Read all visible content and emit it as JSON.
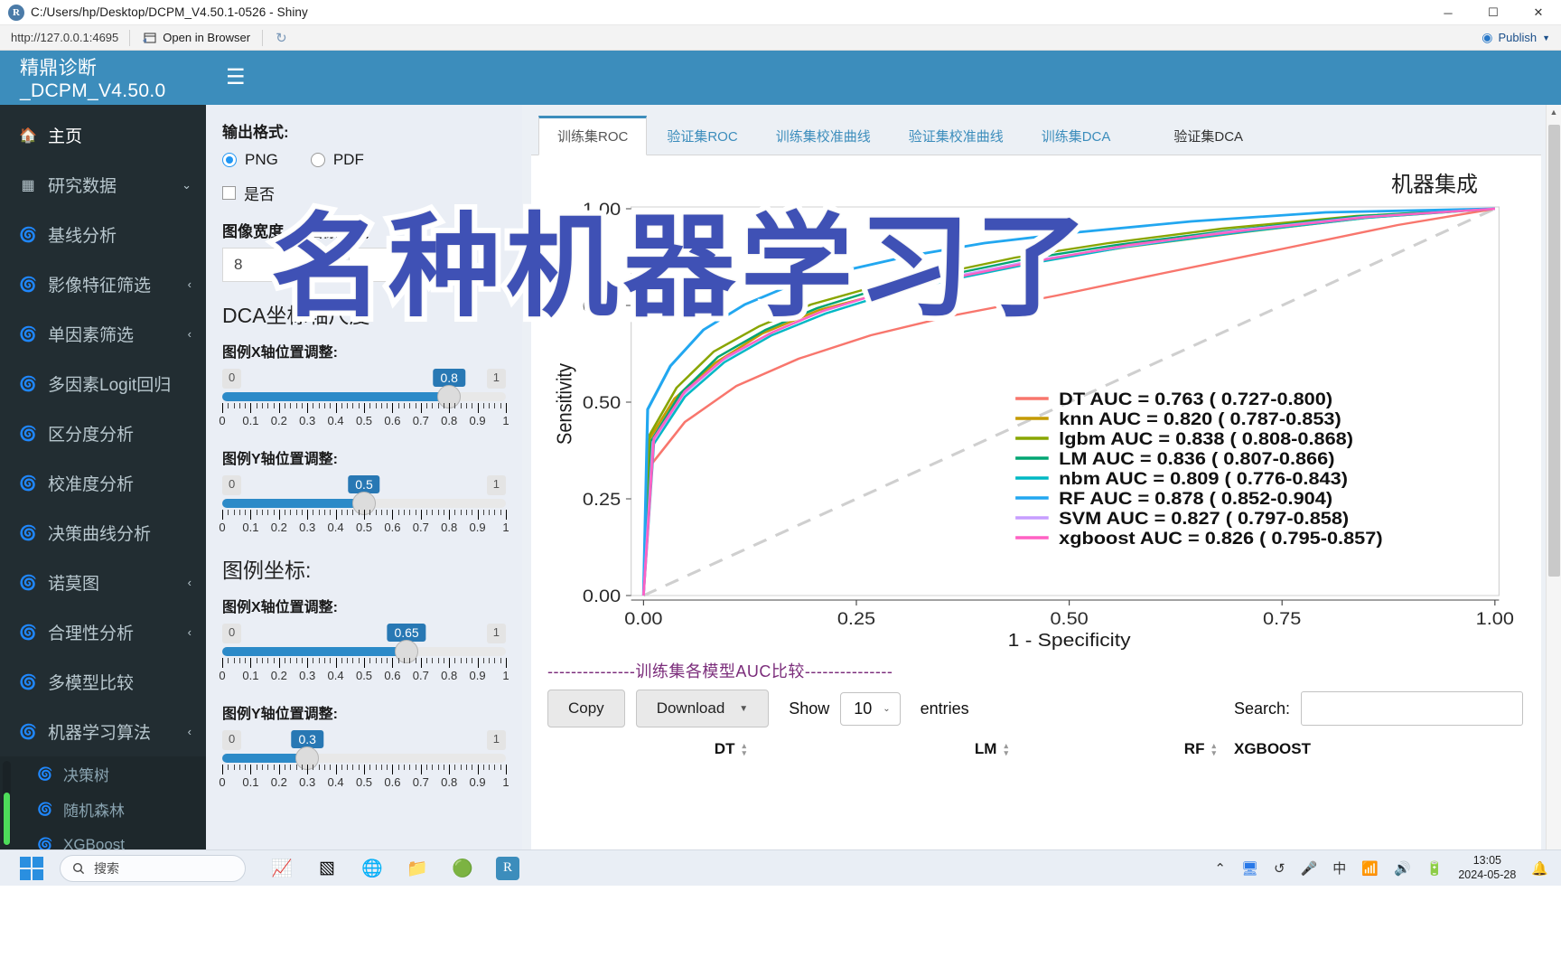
{
  "window": {
    "title": "C:/Users/hp/Desktop/DCPM_V4.50.1-0526 - Shiny",
    "app_icon": "R",
    "minimize": "─",
    "maximize": "☐",
    "close": "✕"
  },
  "shiny_toolbar": {
    "url": "http://127.0.0.1:4695",
    "open_in_browser": "Open in Browser",
    "reload_icon": "reload-icon",
    "publish_label": "Publish",
    "publish_caret": "▼"
  },
  "brand": {
    "title": "精鼎诊断_DCPM_V4.50.0"
  },
  "topbar": {
    "hamburger": "☰"
  },
  "sidebar": {
    "items": [
      {
        "label": "主页",
        "icon": "home-icon",
        "chevron": ""
      },
      {
        "label": "研究数据",
        "icon": "table-icon",
        "chevron": "⌄"
      },
      {
        "label": "基线分析",
        "icon": "chart-icon",
        "chevron": ""
      },
      {
        "label": "影像特征筛选",
        "icon": "chart-icon",
        "chevron": "‹"
      },
      {
        "label": "单因素筛选",
        "icon": "chart-icon",
        "chevron": "‹"
      },
      {
        "label": "多因素Logit回归",
        "icon": "chart-icon",
        "chevron": ""
      },
      {
        "label": "区分度分析",
        "icon": "chart-icon",
        "chevron": ""
      },
      {
        "label": "校准度分析",
        "icon": "chart-icon",
        "chevron": ""
      },
      {
        "label": "决策曲线分析",
        "icon": "chart-icon",
        "chevron": ""
      },
      {
        "label": "诺莫图",
        "icon": "chart-icon",
        "chevron": "‹"
      },
      {
        "label": "合理性分析",
        "icon": "chart-icon",
        "chevron": "‹"
      },
      {
        "label": "多模型比较",
        "icon": "chart-icon",
        "chevron": ""
      },
      {
        "label": "机器学习算法",
        "icon": "chart-icon",
        "chevron": "‹"
      }
    ],
    "subitems": [
      {
        "label": "决策树",
        "icon": "chart-icon"
      },
      {
        "label": "随机森林",
        "icon": "chart-icon"
      },
      {
        "label": "XGBoost",
        "icon": "chart-icon"
      }
    ]
  },
  "controls": {
    "output_format_label": "输出格式:",
    "format_png": "PNG",
    "format_pdf": "PDF",
    "format_selected": "PNG",
    "checkbox_label": "是否",
    "width_label": "图像宽度",
    "height_label": "图像高度",
    "width_value": "8",
    "height_value": "",
    "dca_section_title": "DCA坐标轴尺度",
    "legend_section_title": "图例坐标:",
    "sliders": [
      {
        "label": "图例X轴位置调整:",
        "min": "0",
        "max": "1",
        "value": "0.8",
        "value_num": 0.8
      },
      {
        "label": "图例Y轴位置调整:",
        "min": "0",
        "max": "1",
        "value": "0.5",
        "value_num": 0.5
      },
      {
        "label": "图例X轴位置调整:",
        "min": "0",
        "max": "1",
        "value": "0.65",
        "value_num": 0.65
      },
      {
        "label": "图例Y轴位置调整:",
        "min": "0",
        "max": "1",
        "value": "0.3",
        "value_num": 0.3
      }
    ],
    "tick_labels": [
      "0",
      "0.1",
      "0.2",
      "0.3",
      "0.4",
      "0.5",
      "0.6",
      "0.7",
      "0.8",
      "0.9",
      "1"
    ]
  },
  "tabs": [
    {
      "label": "训练集ROC",
      "active": true
    },
    {
      "label": "验证集ROC",
      "active": false
    },
    {
      "label": "训练集校准曲线",
      "active": false
    },
    {
      "label": "验证集校准曲线",
      "active": false
    },
    {
      "label": "训练集DCA",
      "active": false
    },
    {
      "label": "验证集DCA",
      "active": false
    }
  ],
  "plot_heading": "机器集成",
  "chart_data": {
    "type": "line",
    "title": "机器集成",
    "xlabel": "1 - Specificity",
    "ylabel": "Sensitivity",
    "xlim": [
      0,
      1
    ],
    "ylim": [
      0,
      1
    ],
    "xticks": [
      "0.00",
      "0.25",
      "0.50",
      "0.75",
      "1.00"
    ],
    "yticks": [
      "0.00",
      "0.25",
      "0.50",
      "0.75",
      "1.00"
    ],
    "grid": false,
    "legend_position": "center-right",
    "reference_line": "diagonal dashed grey",
    "series": [
      {
        "name": "DT",
        "legend": "DT AUC = 0.763 ( 0.727-0.800)",
        "auc": 0.763,
        "ci": [
          0.727,
          0.8
        ],
        "color": "#f8766d"
      },
      {
        "name": "knn",
        "legend": "knn AUC = 0.820 ( 0.787-0.853)",
        "auc": 0.82,
        "ci": [
          0.787,
          0.853
        ],
        "color": "#c49a00"
      },
      {
        "name": "lgbm",
        "legend": "lgbm AUC = 0.838 ( 0.808-0.868)",
        "auc": 0.838,
        "ci": [
          0.808,
          0.868
        ],
        "color": "#89a500"
      },
      {
        "name": "LM",
        "legend": "LM AUC = 0.836 ( 0.807-0.866)",
        "auc": 0.836,
        "ci": [
          0.807,
          0.866
        ],
        "color": "#00a572"
      },
      {
        "name": "nbm",
        "legend": "nbm AUC = 0.809 ( 0.776-0.843)",
        "auc": 0.809,
        "ci": [
          0.776,
          0.843
        ],
        "color": "#00b8c4"
      },
      {
        "name": "RF",
        "legend": "RF AUC = 0.878 ( 0.852-0.904)",
        "auc": 0.878,
        "ci": [
          0.852,
          0.904
        ],
        "color": "#22a7f0"
      },
      {
        "name": "SVM",
        "legend": "SVM AUC = 0.827 ( 0.797-0.858)",
        "auc": 0.827,
        "ci": [
          0.797,
          0.858
        ],
        "color": "#c79dff"
      },
      {
        "name": "xgboost",
        "legend": "xgboost AUC = 0.826 ( 0.795-0.857)",
        "auc": 0.826,
        "ci": [
          0.795,
          0.857
        ],
        "color": "#ff61c3"
      }
    ]
  },
  "table_section": {
    "caption": "---------------训练集各模型AUC比较---------------",
    "copy_button": "Copy",
    "download_button": "Download",
    "show_label": "Show",
    "entries_value": "10",
    "entries_label": "entries",
    "search_label": "Search:",
    "search_value": "",
    "search_placeholder": "",
    "columns": [
      "DT",
      "LM",
      "RF",
      "XGBOOST"
    ]
  },
  "watermark": {
    "text": "名种机器学习了",
    "color": "#3f51b5"
  },
  "taskbar": {
    "search_placeholder": "搜索",
    "search_icon": "search-icon",
    "apps": [
      "stock-icon",
      "taskview-icon",
      "edge-icon",
      "folder-icon",
      "meeting-icon",
      "rstudio-icon"
    ],
    "tray": [
      "chevron-up-icon",
      "wps-icon",
      "sync-icon",
      "mic-icon",
      "ime-icon",
      "wifi-icon",
      "volume-icon",
      "battery-icon"
    ],
    "time": "13:05",
    "date": "2024-05-28",
    "notification_icon": "bell-icon"
  }
}
